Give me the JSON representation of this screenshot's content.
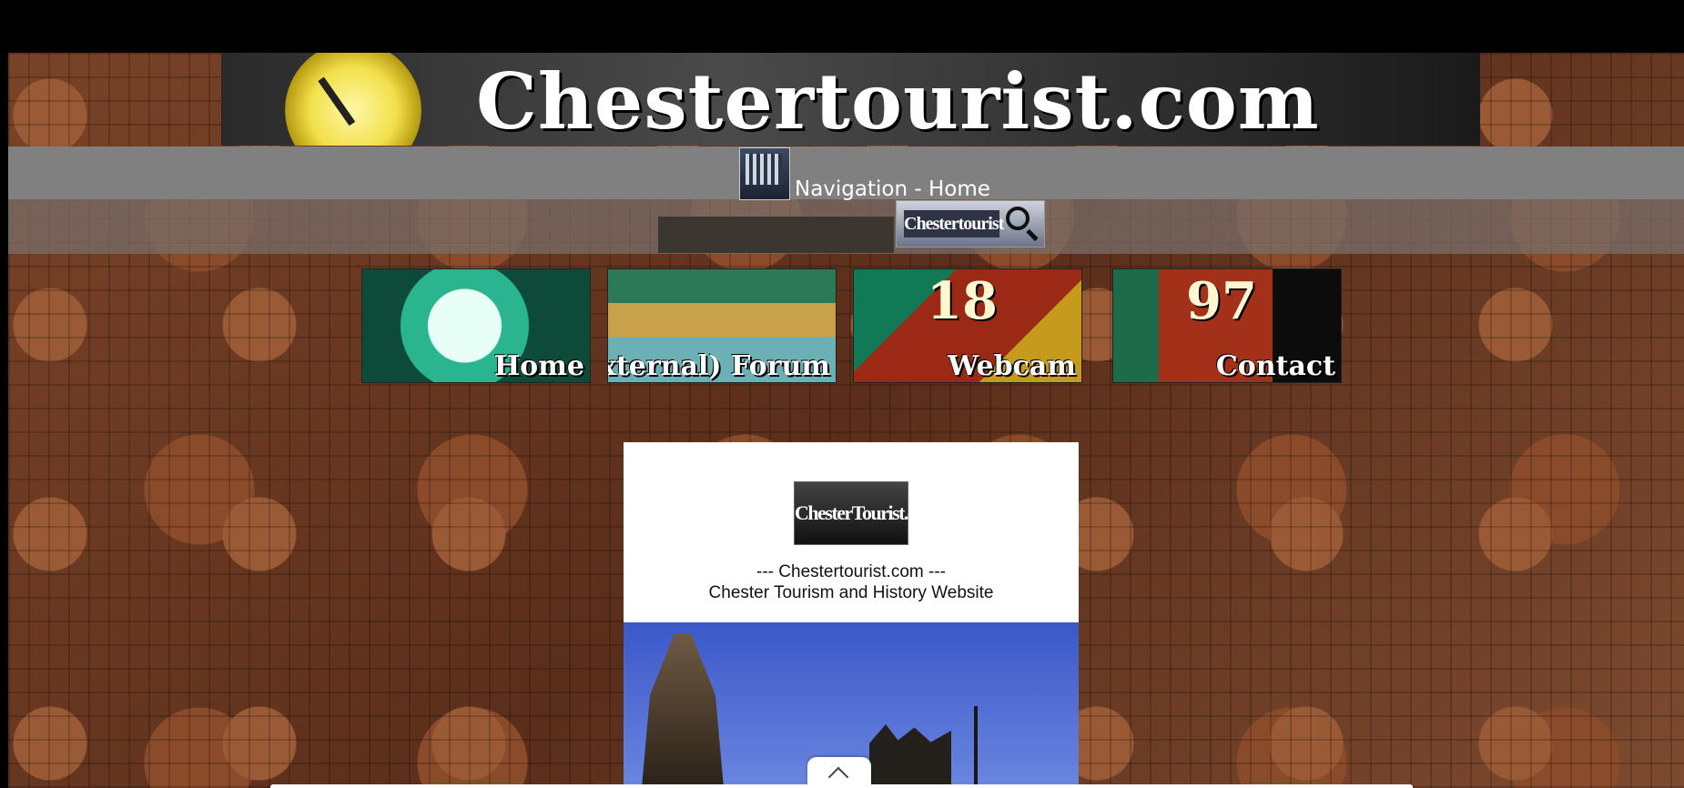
{
  "banner": {
    "title": "Chestertourist.com"
  },
  "nav": {
    "logo_text": "ChesterTourist.com",
    "label": "Navigation - Home",
    "search_placeholder": "",
    "search_button_label": "Chestertourist"
  },
  "tiles": [
    {
      "label": "Home",
      "number": ""
    },
    {
      "label": "(External) Forum",
      "number": ""
    },
    {
      "label": "Webcam",
      "number": "18"
    },
    {
      "label": "Contact",
      "number": "97"
    }
  ],
  "content": {
    "logo_text": "ChesterTourist.com",
    "line1": "--- Chestertourist.com ---",
    "line2": "Chester Tourism and History Website"
  },
  "colors": {
    "nav_bg": "#808080",
    "content_bg": "#ffffff",
    "sky": "#3b58c9"
  }
}
